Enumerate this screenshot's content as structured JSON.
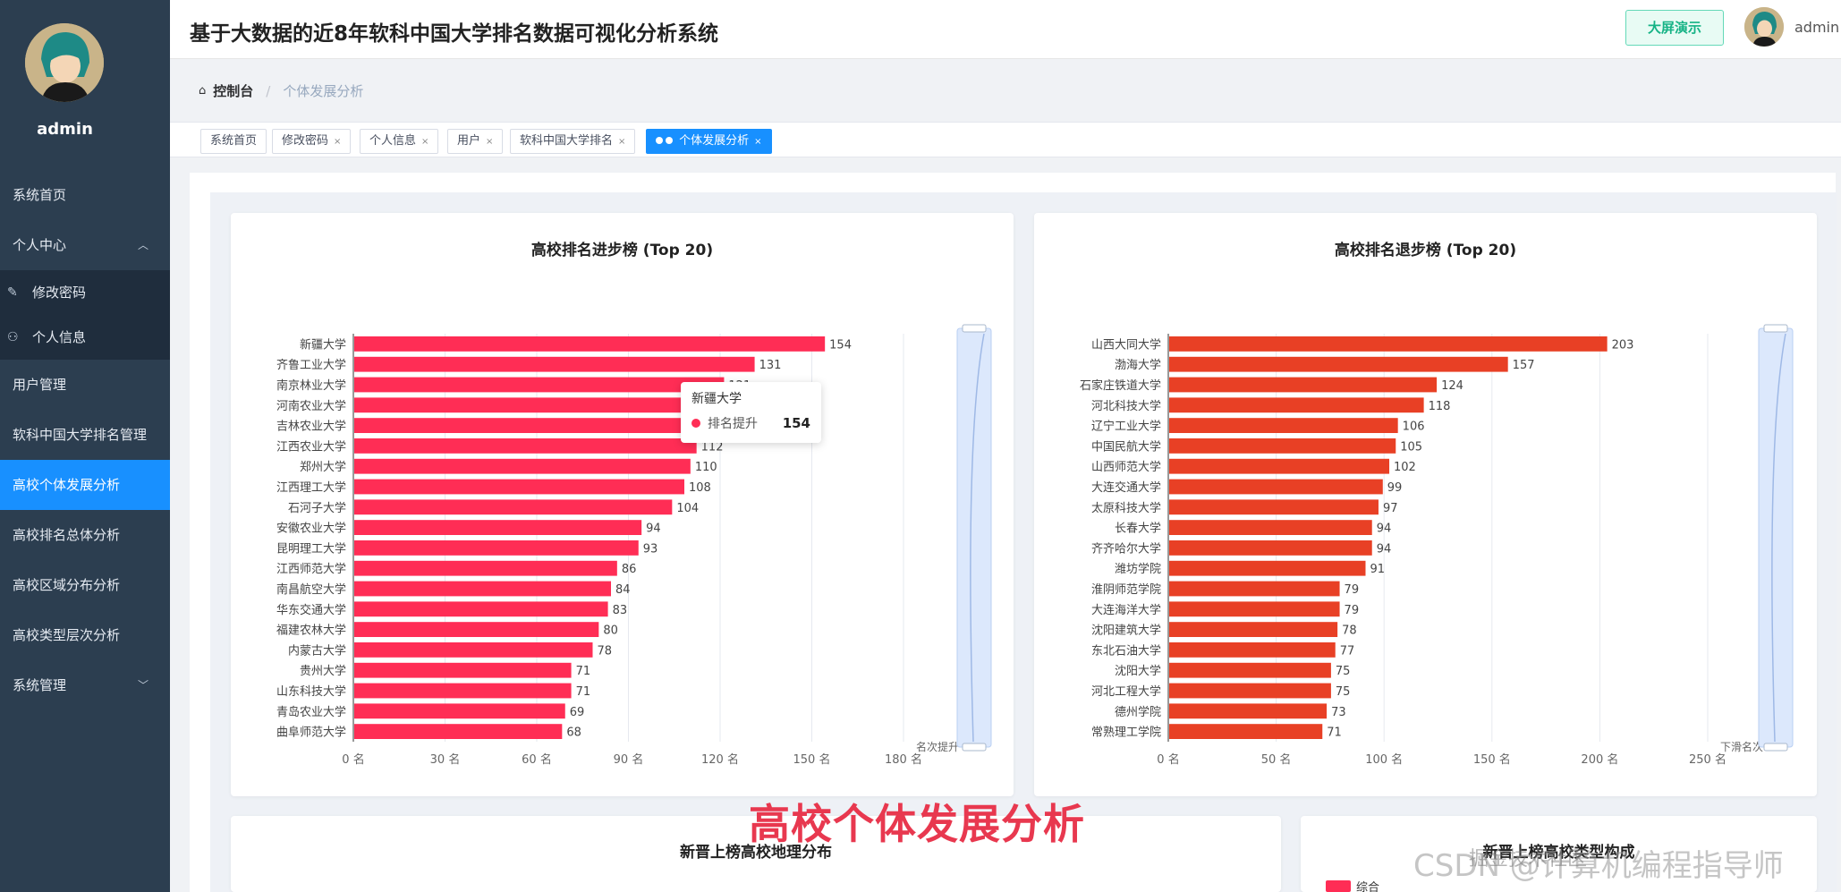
{
  "sidebar": {
    "username": "admin",
    "items": [
      {
        "label": "系统首页"
      },
      {
        "label": "个人中心"
      },
      {
        "label": "修改密码"
      },
      {
        "label": "个人信息"
      },
      {
        "label": "用户管理"
      },
      {
        "label": "软科中国大学排名管理"
      },
      {
        "label": "高校个体发展分析"
      },
      {
        "label": "高校排名总体分析"
      },
      {
        "label": "高校区域分布分析"
      },
      {
        "label": "高校类型层次分析"
      },
      {
        "label": "系统管理"
      }
    ]
  },
  "header": {
    "title": "基于大数据的近8年软科中国大学排名数据可视化分析系统",
    "bigscreen_label": "大屏演示",
    "username": "admin"
  },
  "breadcrumb": {
    "items": [
      "控制台",
      "个体发展分析"
    ]
  },
  "tags": [
    {
      "label": "系统首页"
    },
    {
      "label": "修改密码"
    },
    {
      "label": "个人信息"
    },
    {
      "label": "用户"
    },
    {
      "label": "软科中国大学排名"
    },
    {
      "label": "个体发展分析"
    }
  ],
  "tooltip": {
    "title": "新疆大学",
    "series": "排名提升",
    "value": "154"
  },
  "overlay": {
    "caption": "高校个体发展分析",
    "watermark": "CSDN @计算机编程指导师",
    "watermark2": "掘金技术社区"
  },
  "bottom": {
    "left_title": "新晋上榜高校地理分布",
    "right_title": "新晋上榜高校类型构成",
    "legend_label": "综合"
  },
  "chart_data": [
    {
      "type": "bar",
      "orientation": "horizontal",
      "title": "高校排名进步榜 (Top 20)",
      "categories": [
        "新疆大学",
        "齐鲁工业大学",
        "南京林业大学",
        "河南农业大学",
        "吉林农业大学",
        "江西农业大学",
        "郑州大学",
        "江西理工大学",
        "石河子大学",
        "安徽农业大学",
        "昆明理工大学",
        "江西师范大学",
        "南昌航空大学",
        "华东交通大学",
        "福建农林大学",
        "内蒙古大学",
        "贵州大学",
        "山东科技大学",
        "青岛农业大学",
        "曲阜师范大学"
      ],
      "values": [
        154,
        131,
        121,
        120,
        118,
        112,
        110,
        108,
        104,
        94,
        93,
        86,
        84,
        83,
        80,
        78,
        71,
        71,
        69,
        68
      ],
      "xticks": [
        "0 名",
        "30 名",
        "60 名",
        "90 名",
        "120 名",
        "150 名",
        "180 名"
      ],
      "xlim": [
        0,
        180
      ],
      "xlabel": "名次提升",
      "color": "#ff2d55"
    },
    {
      "type": "bar",
      "orientation": "horizontal",
      "title": "高校排名退步榜 (Top 20)",
      "categories": [
        "山西大同大学",
        "渤海大学",
        "石家庄铁道大学",
        "河北科技大学",
        "辽宁工业大学",
        "中国民航大学",
        "山西师范大学",
        "大连交通大学",
        "太原科技大学",
        "长春大学",
        "齐齐哈尔大学",
        "潍坊学院",
        "淮阴师范学院",
        "大连海洋大学",
        "沈阳建筑大学",
        "东北石油大学",
        "沈阳大学",
        "河北工程大学",
        "德州学院",
        "常熟理工学院"
      ],
      "values": [
        203,
        157,
        124,
        118,
        106,
        105,
        102,
        99,
        97,
        94,
        94,
        91,
        79,
        79,
        78,
        77,
        75,
        75,
        73,
        71
      ],
      "xticks": [
        "0 名",
        "50 名",
        "100 名",
        "150 名",
        "200 名",
        "250 名"
      ],
      "xlim": [
        0,
        250
      ],
      "xlabel": "下滑名次",
      "color": "#e84025"
    }
  ]
}
